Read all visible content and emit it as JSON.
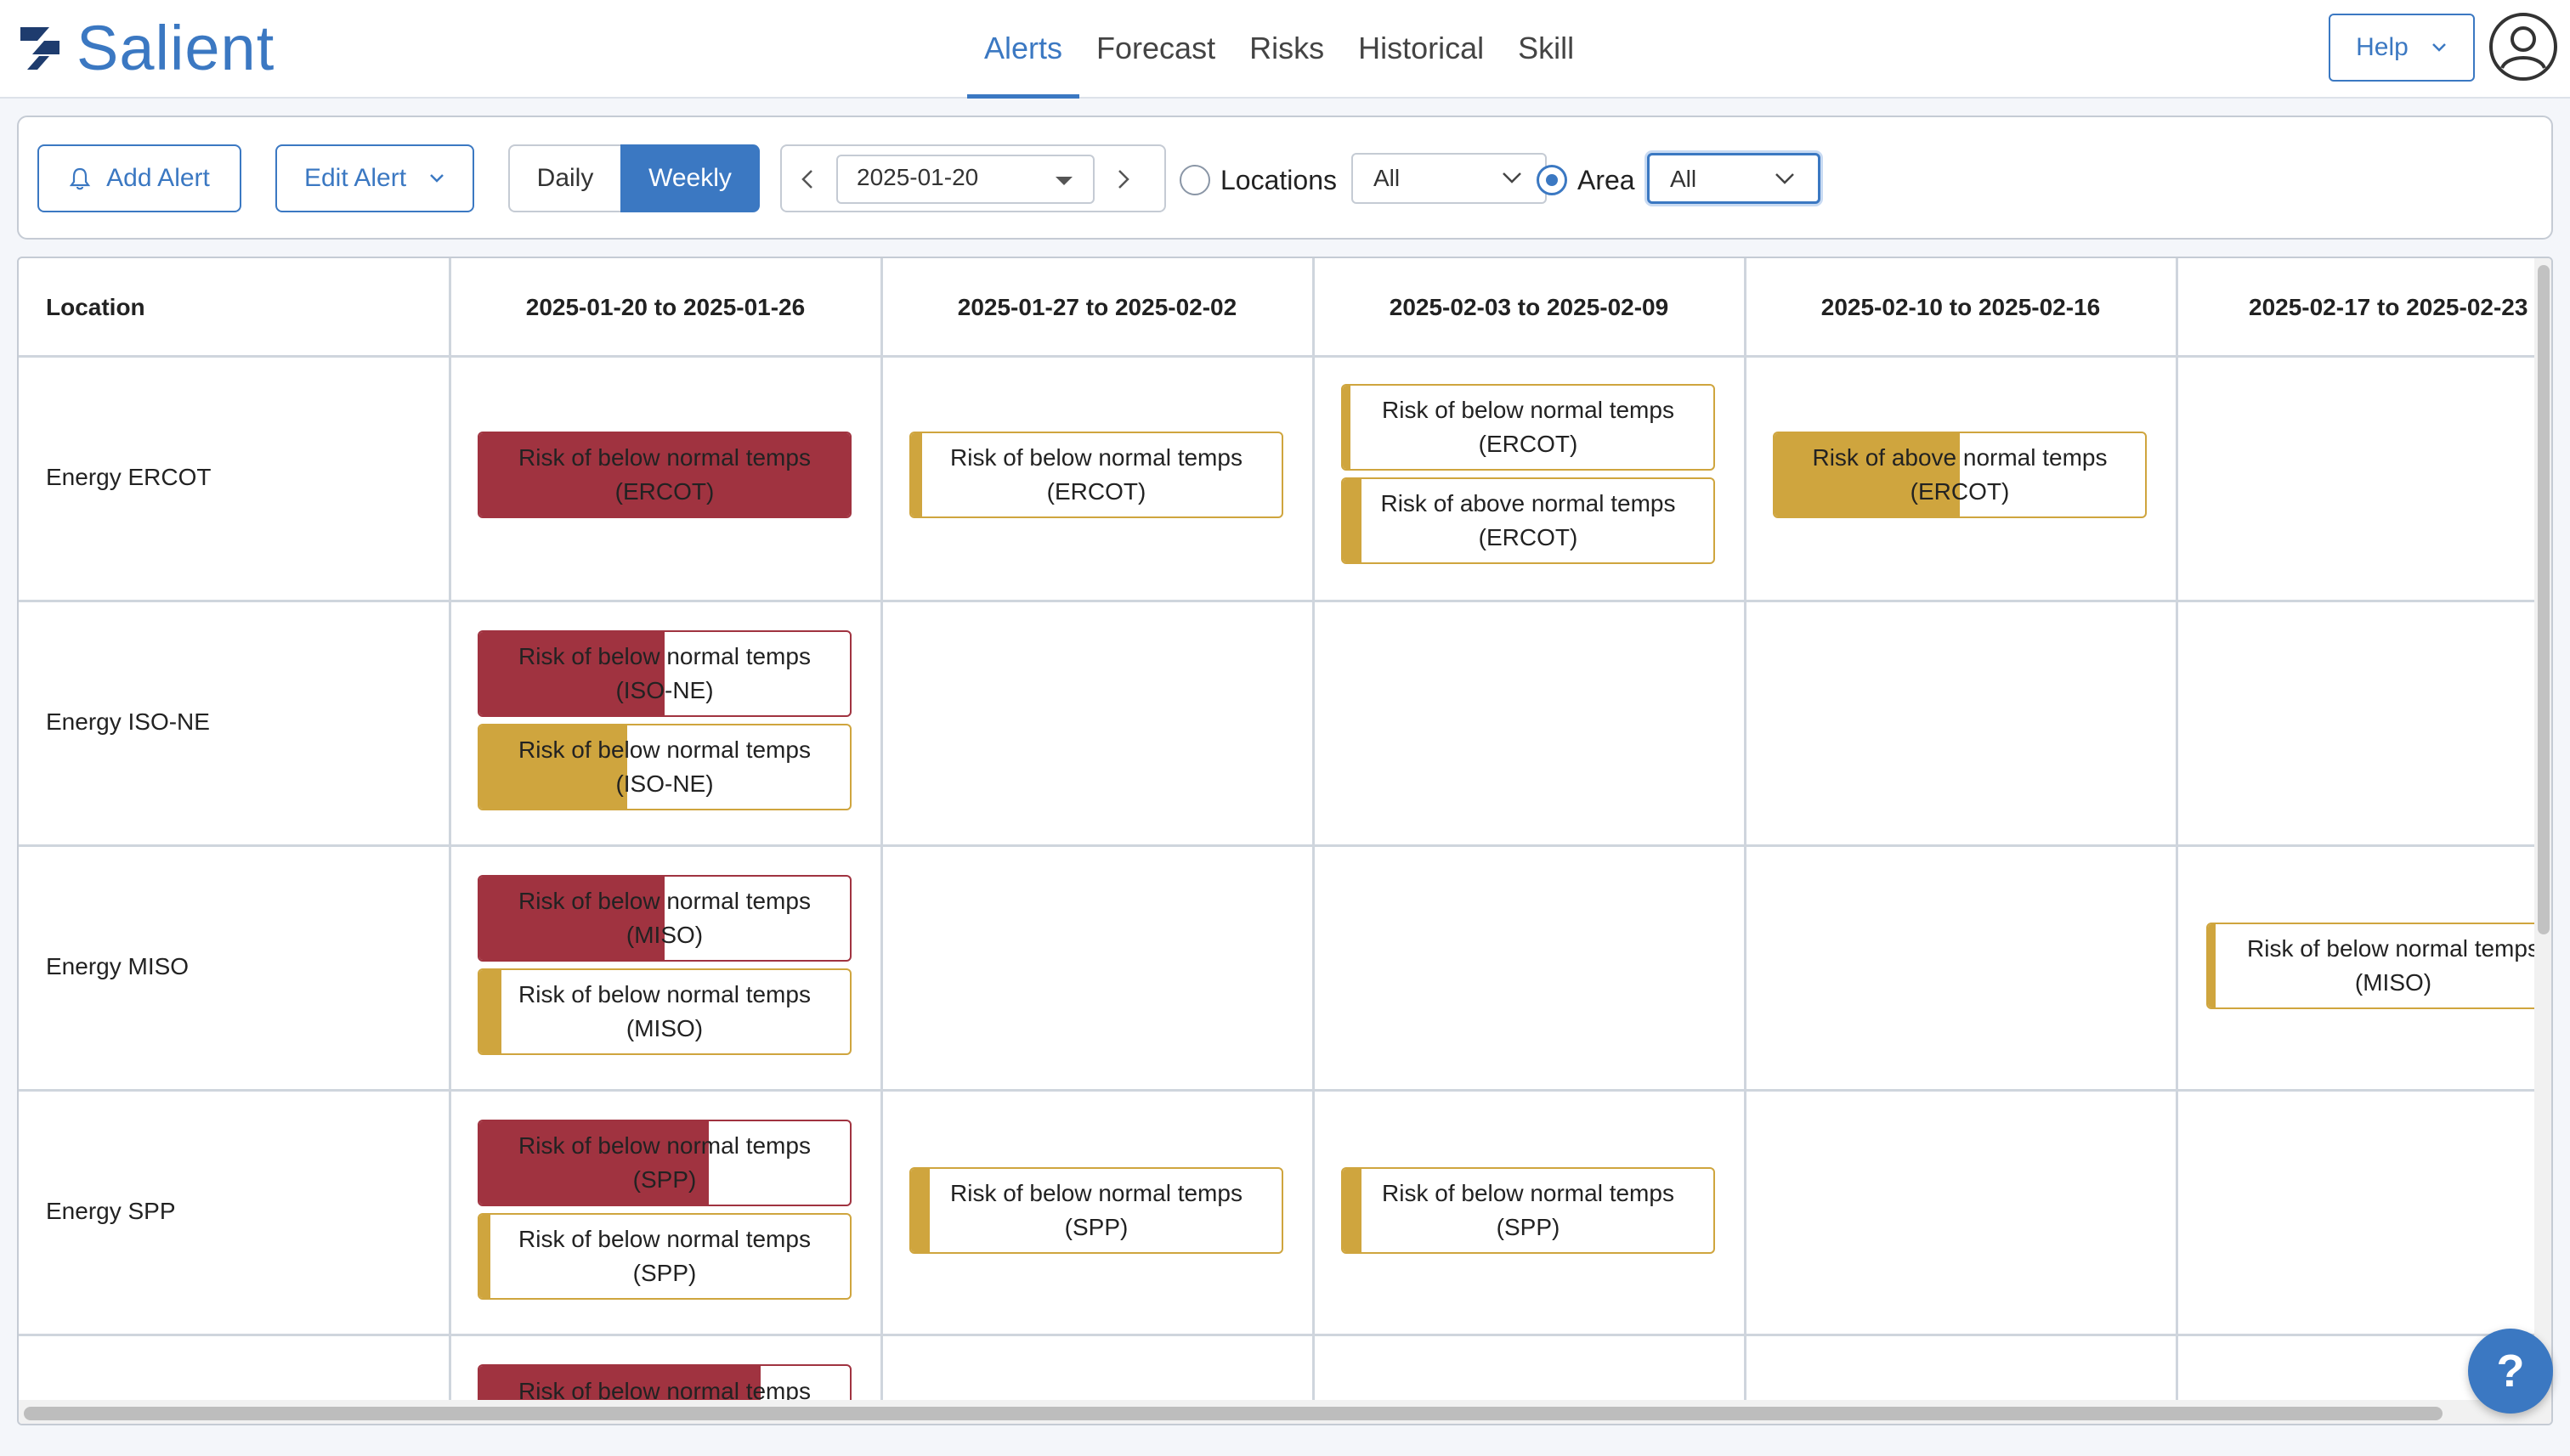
{
  "app": {
    "name": "Salient"
  },
  "nav": {
    "items": [
      "Alerts",
      "Forecast",
      "Risks",
      "Historical",
      "Skill"
    ],
    "active": "Alerts"
  },
  "header": {
    "help_label": "Help"
  },
  "toolbar": {
    "add_alert": "Add Alert",
    "edit_alert": "Edit Alert",
    "daily": "Daily",
    "weekly": "Weekly",
    "selected_mode": "Weekly",
    "date_value": "2025-01-20",
    "locations_label": "Locations",
    "locations_value": "All",
    "area_label": "Area",
    "area_value": "All",
    "selected_radio": "Area"
  },
  "table": {
    "location_header": "Location",
    "week_headers": [
      "2025-01-20 to 2025-01-26",
      "2025-01-27 to 2025-02-02",
      "2025-02-03 to 2025-02-09",
      "2025-02-10 to 2025-02-16",
      "2025-02-17 to 2025-02-23"
    ],
    "rows": [
      {
        "location": "Energy ERCOT"
      },
      {
        "location": "Energy ISO-NE"
      },
      {
        "location": "Energy MISO"
      },
      {
        "location": "Energy SPP"
      }
    ],
    "alerts": {
      "ercot_w1": {
        "line1": "Risk of below normal temps",
        "line2": "(ERCOT)",
        "color": "#a03340",
        "fill": 1.0
      },
      "ercot_w2": {
        "line1": "Risk of below normal temps",
        "line2": "(ERCOT)",
        "color": "#cfa53e",
        "fill": 0.03
      },
      "ercot_w3a": {
        "line1": "Risk of below normal temps",
        "line2": "(ERCOT)",
        "color": "#cfa53e",
        "fill": 0.02
      },
      "ercot_w3b": {
        "line1": "Risk of above normal temps",
        "line2": "(ERCOT)",
        "color": "#cfa53e",
        "fill": 0.05
      },
      "ercot_w4": {
        "line1": "Risk of above normal temps",
        "line2": "(ERCOT)",
        "color": "#cfa53e",
        "fill": 0.5
      },
      "isone_w1a": {
        "line1": "Risk of below normal temps",
        "line2": "(ISO-NE)",
        "color": "#a03340",
        "fill": 0.5
      },
      "isone_w1b": {
        "line1": "Risk of below normal temps",
        "line2": "(ISO-NE)",
        "color": "#cfa53e",
        "fill": 0.4
      },
      "miso_w1a": {
        "line1": "Risk of below normal temps",
        "line2": "(MISO)",
        "color": "#a03340",
        "fill": 0.5
      },
      "miso_w1b": {
        "line1": "Risk of below normal temps",
        "line2": "(MISO)",
        "color": "#cfa53e",
        "fill": 0.06
      },
      "miso_w5": {
        "line1": "Risk of below normal temps",
        "line2": "(MISO)",
        "color": "#cfa53e",
        "fill": 0.02
      },
      "spp_w1a": {
        "line1": "Risk of below normal temps",
        "line2": "(SPP)",
        "color": "#a03340",
        "fill": 0.62
      },
      "spp_w1b": {
        "line1": "Risk of below normal temps",
        "line2": "(SPP)",
        "color": "#cfa53e",
        "fill": 0.03
      },
      "spp_w2": {
        "line1": "Risk of below normal temps",
        "line2": "(SPP)",
        "color": "#cfa53e",
        "fill": 0.05
      },
      "spp_w3": {
        "line1": "Risk of below normal temps",
        "line2": "(SPP)",
        "color": "#cfa53e",
        "fill": 0.05
      },
      "row5_w1": {
        "line1": "Risk of below normal temps",
        "line2": "",
        "color": "#a03340",
        "fill": 0.76
      }
    }
  },
  "help_fab": "?"
}
